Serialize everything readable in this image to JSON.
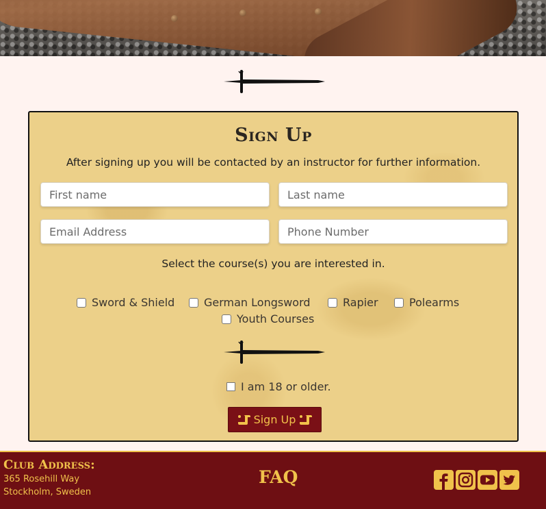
{
  "hero": {
    "alt": "chainmail and leather scabbard"
  },
  "form": {
    "title": "Sign Up",
    "intro": "After signing up you will be contacted by an instructor for further information.",
    "first_name_placeholder": "First name",
    "last_name_placeholder": "Last name",
    "email_placeholder": "Email Address",
    "phone_placeholder": "Phone Number",
    "courses_prompt": "Select the course(s) you are interested in.",
    "courses": [
      "Sword & Shield",
      "German Longsword",
      "Rapier",
      "Polearms",
      "Youth Courses"
    ],
    "age_label": "I am 18 or older.",
    "submit_label": "Sign Up"
  },
  "footer": {
    "address_title": "Club Address:",
    "address_line1": "365 Rosehill Way",
    "address_line2": "Stockholm, Sweden",
    "faq_label": "FAQ",
    "social": [
      "facebook-icon",
      "instagram-icon",
      "youtube-icon",
      "twitter-icon"
    ]
  },
  "colors": {
    "accent": "#f0c24b",
    "brand": "#6e0f13",
    "card": "#ecd089",
    "page": "#fff3f0"
  }
}
